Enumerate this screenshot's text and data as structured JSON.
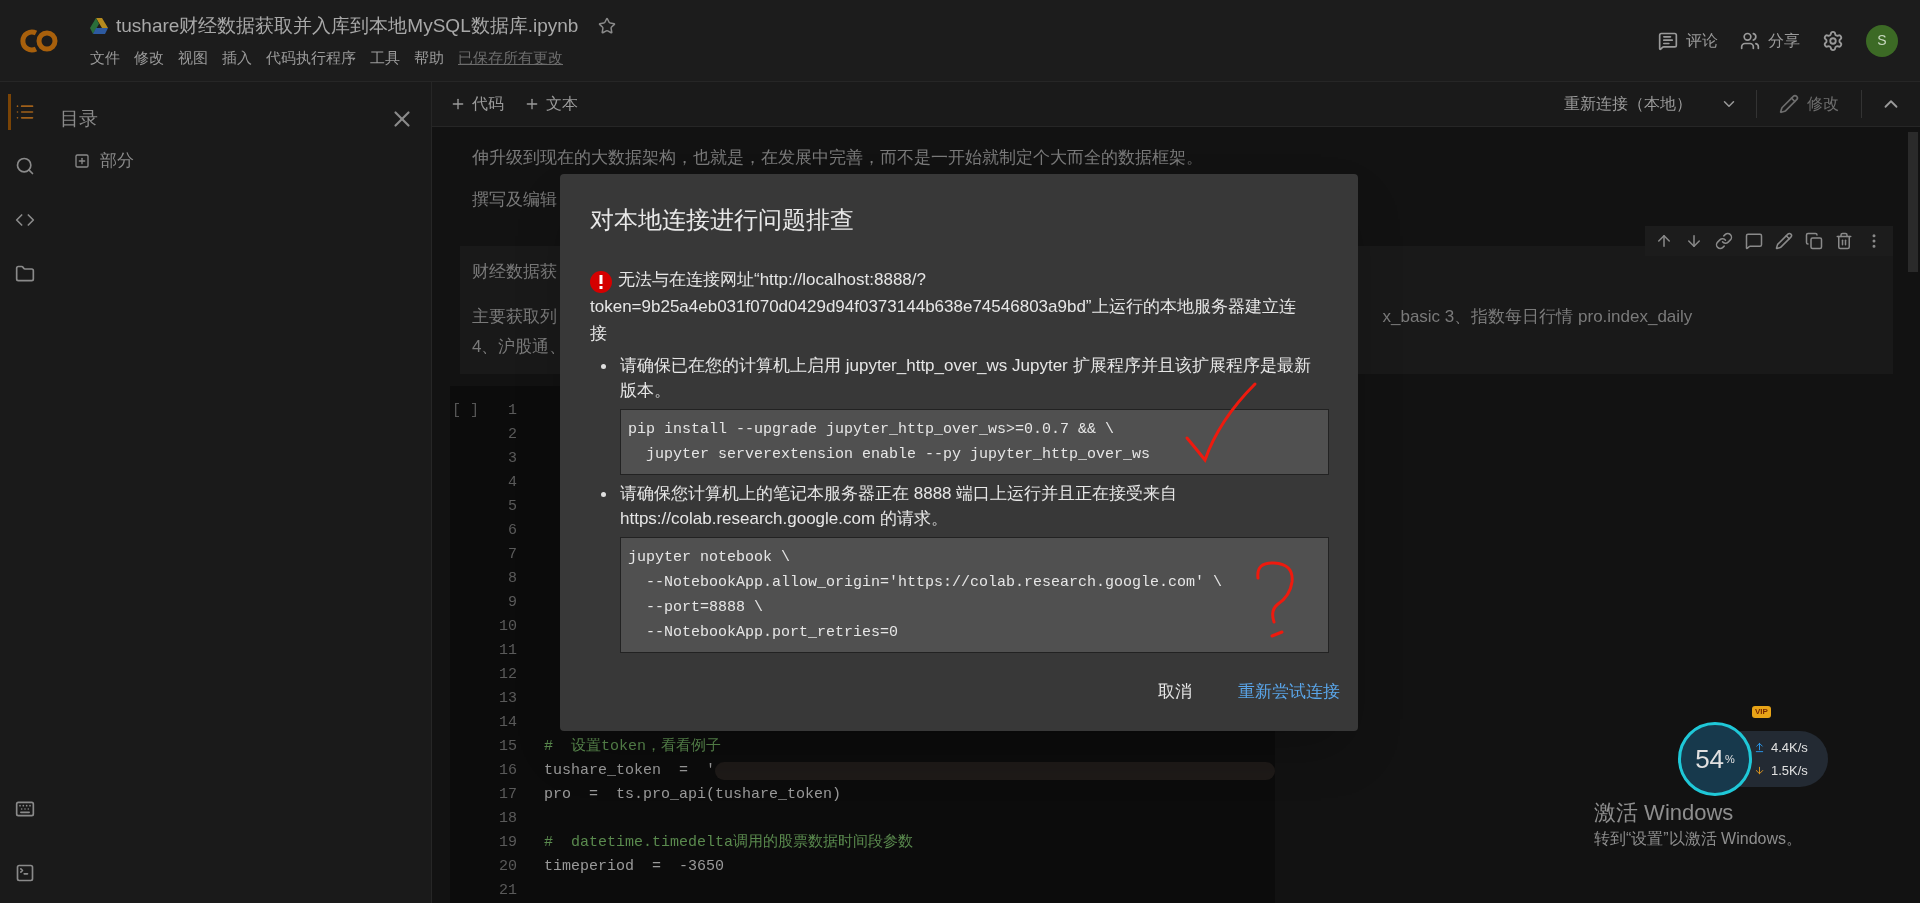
{
  "header": {
    "title": "tushare财经数据获取并入库到本地MySQL数据库.ipynb",
    "starred": false,
    "menu": [
      "文件",
      "修改",
      "视图",
      "插入",
      "代码执行程序",
      "工具",
      "帮助"
    ],
    "save_status": "已保存所有更改",
    "actions": [
      "评论",
      "分享"
    ],
    "avatar": "S"
  },
  "rail": [
    {
      "kind": "list",
      "selected": true
    },
    {
      "kind": "search",
      "selected": false
    },
    {
      "kind": "code",
      "selected": false
    },
    {
      "kind": "folder",
      "selected": false
    }
  ],
  "sidebar": {
    "title": "目录",
    "items": [
      {
        "label": "部分"
      }
    ]
  },
  "toolbar": {
    "add": [
      "代码",
      "文本"
    ],
    "connect": "重新连接（本地）",
    "edit": "修改"
  },
  "text_cell": {
    "line": "伸升级到现在的大数据架构，也就是，在发展中完善，而不是一开始就制定个大而全的数据框架。",
    "fragment": "撰写及编辑"
  },
  "md_cell": {
    "title_fragment": "财经数据获",
    "left_fragments": [
      "主要获取列",
      "4、沪股通、"
    ],
    "right_fragment": "x_basic 3、指数每日行情 pro.index_daily"
  },
  "code_cell": {
    "run_marker": "[ ]",
    "lines": [
      {
        "number": "1"
      },
      {
        "number": "2"
      },
      {
        "number": "3"
      },
      {
        "number": "4"
      },
      {
        "number": "5"
      },
      {
        "number": "6"
      },
      {
        "number": "7"
      },
      {
        "number": "8"
      },
      {
        "number": "9"
      },
      {
        "number": "10"
      },
      {
        "number": "11"
      },
      {
        "number": "12"
      },
      {
        "number": "13"
      },
      {
        "number": "14"
      },
      {
        "number": "15",
        "kind": "comment",
        "code": "#  设置token，看看例子"
      },
      {
        "number": "16",
        "kind": "code",
        "code": "tushare_token  =  '",
        "redacted": true
      },
      {
        "number": "17",
        "kind": "code",
        "code": "pro  =  ts.pro_api(tushare_token)"
      },
      {
        "number": "18"
      },
      {
        "number": "19",
        "kind": "comment",
        "code": "#  datetime.timedelta调用的股票数据时间段参数"
      },
      {
        "number": "20",
        "kind": "code",
        "code": "timeperiod  =  -3650"
      },
      {
        "number": "21"
      }
    ]
  },
  "dialog": {
    "title": "对本地连接进行问题排查",
    "error": "无法与在连接网址“http://localhost:8888/?token=9b25a4eb031f070d0429d94f0373144b638e74546803a9bd”上运行的本地服务器建立连接",
    "bullets": [
      {
        "text": "请确保已在您的计算机上启用 jupyter_http_over_ws Jupyter 扩展程序并且该扩展程序是最新版本。",
        "code": [
          "pip install --upgrade jupyter_http_over_ws>=0.0.7 && \\",
          "  jupyter serverextension enable --py jupyter_http_over_ws"
        ]
      },
      {
        "text": "请确保您计算机上的笔记本服务器正在 8888 端口上运行并且正在接受来自 https://colab.research.google.com 的请求。",
        "code": [
          "jupyter notebook \\",
          "  --NotebookApp.allow_origin='https://colab.research.google.com' \\",
          "  --port=8888 \\",
          "  --NotebookApp.port_retries=0"
        ]
      }
    ],
    "buttons": [
      {
        "label": "取消",
        "kind": "plain"
      },
      {
        "label": "重新尝试连接",
        "kind": "primary"
      }
    ]
  },
  "windows_notice": {
    "title": "激活 Windows",
    "subtitle": "转到“设置”以激活 Windows。"
  },
  "net_meter": {
    "percent": "54",
    "unit": "%",
    "badge": "VIP",
    "up": "4.4K/s",
    "down": "1.5K/s"
  }
}
